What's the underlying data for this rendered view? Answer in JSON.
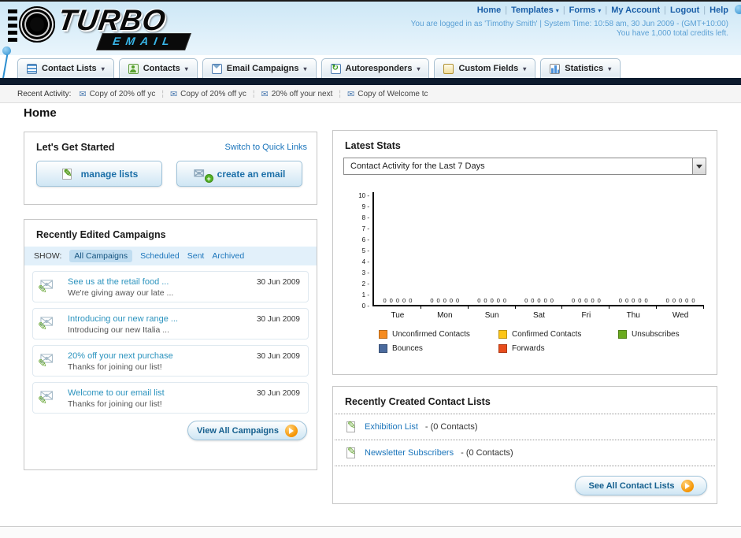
{
  "header": {
    "logo_line1": "TURBO",
    "logo_line2": "EMAIL",
    "nav": {
      "home": "Home",
      "templates": "Templates",
      "forms": "Forms",
      "my_account": "My Account",
      "logout": "Logout",
      "help": "Help"
    },
    "login_info": "You are logged in as 'Timothy Smith' | System Time: 10:58 am, 30 Jun 2009 - (GMT+10:00)",
    "credits_info": "You have 1,000 total credits left."
  },
  "main_nav": {
    "tabs": [
      {
        "label": "Contact Lists"
      },
      {
        "label": "Contacts"
      },
      {
        "label": "Email Campaigns"
      },
      {
        "label": "Autoresponders"
      },
      {
        "label": "Custom Fields"
      },
      {
        "label": "Statistics"
      }
    ]
  },
  "recent_activity": {
    "label": "Recent Activity:",
    "items": [
      {
        "text": "Copy of 20% off yc"
      },
      {
        "text": "Copy of 20% off yc"
      },
      {
        "text": "20% off your next"
      },
      {
        "text": "Copy of Welcome tc"
      }
    ]
  },
  "page": {
    "title": "Home"
  },
  "get_started": {
    "title": "Let's Get Started",
    "switch_link": "Switch to Quick Links",
    "manage_lists_label": "manage lists",
    "create_email_label": "create an email"
  },
  "campaigns": {
    "title": "Recently Edited Campaigns",
    "show_label": "SHOW:",
    "filters": [
      "All Campaigns",
      "Scheduled",
      "Sent",
      "Archived"
    ],
    "active_filter": "All Campaigns",
    "items": [
      {
        "title": "See us at the retail food ...",
        "subtitle": "We're giving away our late ...",
        "date": "30 Jun 2009"
      },
      {
        "title": "Introducing our new range ...",
        "subtitle": "Introducing our new Italia ...",
        "date": "30 Jun 2009"
      },
      {
        "title": "20% off your next purchase",
        "subtitle": "Thanks for joining our list!",
        "date": "30 Jun 2009"
      },
      {
        "title": "Welcome to our email list",
        "subtitle": "Thanks for joining our list!",
        "date": "30 Jun 2009"
      }
    ],
    "view_all_label": "View All Campaigns"
  },
  "latest_stats": {
    "title": "Latest Stats",
    "dropdown_value": "Contact Activity for the Last 7 Days",
    "chart_data": {
      "type": "bar",
      "categories": [
        "Tue",
        "Mon",
        "Sun",
        "Sat",
        "Fri",
        "Thu",
        "Wed"
      ],
      "series": [
        {
          "name": "Unconfirmed Contacts",
          "color": "#f68b1f",
          "values": [
            0,
            0,
            0,
            0,
            0,
            0,
            0
          ]
        },
        {
          "name": "Confirmed Contacts",
          "color": "#fdc516",
          "values": [
            0,
            0,
            0,
            0,
            0,
            0,
            0
          ]
        },
        {
          "name": "Unsubscribes",
          "color": "#6aaa1e",
          "values": [
            0,
            0,
            0,
            0,
            0,
            0,
            0
          ]
        },
        {
          "name": "Bounces",
          "color": "#4a6a9d",
          "values": [
            0,
            0,
            0,
            0,
            0,
            0,
            0
          ]
        },
        {
          "name": "Forwards",
          "color": "#e84d1c",
          "values": [
            0,
            0,
            0,
            0,
            0,
            0,
            0
          ]
        }
      ],
      "ylim": [
        0,
        10
      ],
      "yticks": [
        0,
        1,
        2,
        3,
        4,
        5,
        6,
        7,
        8,
        9,
        10
      ],
      "legend_position": "bottom",
      "grid": false
    }
  },
  "contact_lists": {
    "title": "Recently Created Contact Lists",
    "items": [
      {
        "name": "Exhibition List",
        "detail": "- (0 Contacts)"
      },
      {
        "name": "Newsletter Subscribers",
        "detail": "- (0 Contacts)"
      }
    ],
    "see_all_label": "See All Contact Lists"
  }
}
